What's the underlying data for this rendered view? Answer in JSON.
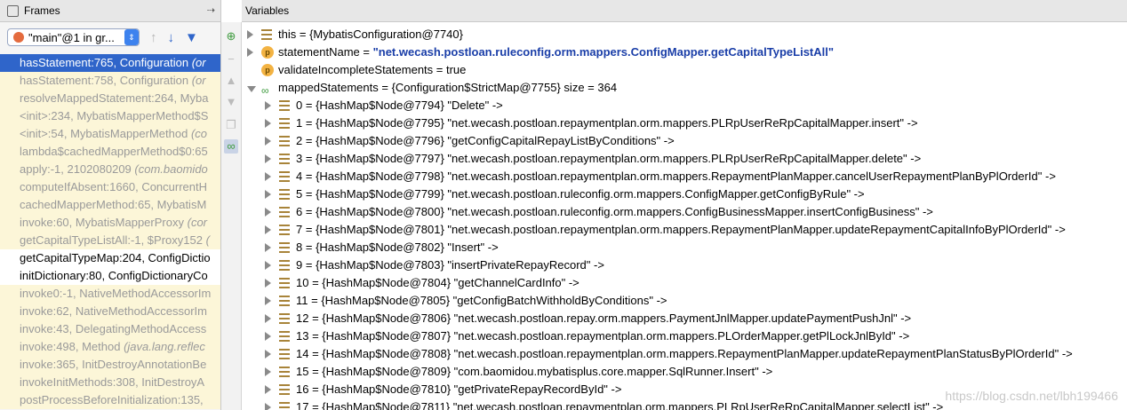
{
  "frames_panel": {
    "title": "Frames",
    "pin_glyph": "⇢",
    "thread_label": "\"main\"@1 in gr...",
    "frames": [
      {
        "method": "hasStatement:765, Configuration",
        "cls": "(or",
        "state": "selected"
      },
      {
        "method": "hasStatement:758, Configuration",
        "cls": "(or",
        "state": "lib"
      },
      {
        "method": "resolveMappedStatement:264, Myba",
        "cls": "",
        "state": "lib"
      },
      {
        "method": "<init>:234, MybatisMapperMethod$S",
        "cls": "",
        "state": "lib"
      },
      {
        "method": "<init>:54, MybatisMapperMethod",
        "cls": "(co",
        "state": "lib"
      },
      {
        "method": "lambda$cachedMapperMethod$0:65",
        "cls": "",
        "state": "lib"
      },
      {
        "method": "apply:-1, 2102080209",
        "cls": "(com.baomido",
        "state": "lib"
      },
      {
        "method": "computeIfAbsent:1660, ConcurrentH",
        "cls": "",
        "state": "lib"
      },
      {
        "method": "cachedMapperMethod:65, MybatisM",
        "cls": "",
        "state": "lib"
      },
      {
        "method": "invoke:60, MybatisMapperProxy",
        "cls": "(cor",
        "state": "lib"
      },
      {
        "method": "getCapitalTypeListAll:-1, $Proxy152",
        "cls": "(",
        "state": "lib"
      },
      {
        "method": "getCapitalTypeMap:204, ConfigDictio",
        "cls": "",
        "state": "own"
      },
      {
        "method": "initDictionary:80, ConfigDictionaryCo",
        "cls": "",
        "state": "own"
      },
      {
        "method": "invoke0:-1, NativeMethodAccessorIm",
        "cls": "",
        "state": "lib"
      },
      {
        "method": "invoke:62, NativeMethodAccessorIm",
        "cls": "",
        "state": "lib"
      },
      {
        "method": "invoke:43, DelegatingMethodAccess",
        "cls": "",
        "state": "lib"
      },
      {
        "method": "invoke:498, Method",
        "cls": "(java.lang.reflec",
        "state": "lib"
      },
      {
        "method": "invoke:365, InitDestroyAnnotationBe",
        "cls": "",
        "state": "lib"
      },
      {
        "method": "invokeInitMethods:308, InitDestroyA",
        "cls": "",
        "state": "lib"
      },
      {
        "method": "postProcessBeforeInitialization:135,",
        "cls": "",
        "state": "lib"
      }
    ]
  },
  "variables_panel": {
    "title": "Variables",
    "vars": [
      {
        "indent": 0,
        "expand": "right",
        "icon": "field",
        "name": "this",
        "value": "{MybatisConfiguration@7740}",
        "str": ""
      },
      {
        "indent": 0,
        "expand": "right",
        "icon": "param",
        "name": "statementName",
        "value": "",
        "str": "\"net.wecash.postloan.ruleconfig.orm.mappers.ConfigMapper.getCapitalTypeListAll\""
      },
      {
        "indent": 0,
        "expand": "none",
        "icon": "param",
        "name": "validateIncompleteStatements",
        "value": "true",
        "str": ""
      },
      {
        "indent": 0,
        "expand": "down",
        "icon": "watch",
        "name": "mappedStatements",
        "value": "{Configuration$StrictMap@7755}  size = 364",
        "str": ""
      },
      {
        "indent": 1,
        "expand": "right",
        "icon": "field",
        "name": "0",
        "value": "{HashMap$Node@7794} \"Delete\" ->",
        "str": ""
      },
      {
        "indent": 1,
        "expand": "right",
        "icon": "field",
        "name": "1",
        "value": "{HashMap$Node@7795} \"net.wecash.postloan.repaymentplan.orm.mappers.PLRpUserReRpCapitalMapper.insert\" ->",
        "str": ""
      },
      {
        "indent": 1,
        "expand": "right",
        "icon": "field",
        "name": "2",
        "value": "{HashMap$Node@7796} \"getConfigCapitalRepayListByConditions\" ->",
        "str": ""
      },
      {
        "indent": 1,
        "expand": "right",
        "icon": "field",
        "name": "3",
        "value": "{HashMap$Node@7797} \"net.wecash.postloan.repaymentplan.orm.mappers.PLRpUserReRpCapitalMapper.delete\" ->",
        "str": ""
      },
      {
        "indent": 1,
        "expand": "right",
        "icon": "field",
        "name": "4",
        "value": "{HashMap$Node@7798} \"net.wecash.postloan.repaymentplan.orm.mappers.RepaymentPlanMapper.cancelUserRepaymentPlanByPlOrderId\" ->",
        "str": ""
      },
      {
        "indent": 1,
        "expand": "right",
        "icon": "field",
        "name": "5",
        "value": "{HashMap$Node@7799} \"net.wecash.postloan.ruleconfig.orm.mappers.ConfigMapper.getConfigByRule\" ->",
        "str": ""
      },
      {
        "indent": 1,
        "expand": "right",
        "icon": "field",
        "name": "6",
        "value": "{HashMap$Node@7800} \"net.wecash.postloan.ruleconfig.orm.mappers.ConfigBusinessMapper.insertConfigBusiness\" ->",
        "str": ""
      },
      {
        "indent": 1,
        "expand": "right",
        "icon": "field",
        "name": "7",
        "value": "{HashMap$Node@7801} \"net.wecash.postloan.repaymentplan.orm.mappers.RepaymentPlanMapper.updateRepaymentCapitalInfoByPlOrderId\" ->",
        "str": ""
      },
      {
        "indent": 1,
        "expand": "right",
        "icon": "field",
        "name": "8",
        "value": "{HashMap$Node@7802} \"Insert\" ->",
        "str": ""
      },
      {
        "indent": 1,
        "expand": "right",
        "icon": "field",
        "name": "9",
        "value": "{HashMap$Node@7803} \"insertPrivateRepayRecord\" ->",
        "str": ""
      },
      {
        "indent": 1,
        "expand": "right",
        "icon": "field",
        "name": "10",
        "value": "{HashMap$Node@7804} \"getChannelCardInfo\" ->",
        "str": ""
      },
      {
        "indent": 1,
        "expand": "right",
        "icon": "field",
        "name": "11",
        "value": "{HashMap$Node@7805} \"getConfigBatchWithholdByConditions\" ->",
        "str": ""
      },
      {
        "indent": 1,
        "expand": "right",
        "icon": "field",
        "name": "12",
        "value": "{HashMap$Node@7806} \"net.wecash.postloan.repay.orm.mappers.PaymentJnlMapper.updatePaymentPushJnl\" ->",
        "str": ""
      },
      {
        "indent": 1,
        "expand": "right",
        "icon": "field",
        "name": "13",
        "value": "{HashMap$Node@7807} \"net.wecash.postloan.repaymentplan.orm.mappers.PLOrderMapper.getPlLockJnlById\" ->",
        "str": ""
      },
      {
        "indent": 1,
        "expand": "right",
        "icon": "field",
        "name": "14",
        "value": "{HashMap$Node@7808} \"net.wecash.postloan.repaymentplan.orm.mappers.RepaymentPlanMapper.updateRepaymentPlanStatusByPlOrderId\" ->",
        "str": ""
      },
      {
        "indent": 1,
        "expand": "right",
        "icon": "field",
        "name": "15",
        "value": "{HashMap$Node@7809} \"com.baomidou.mybatisplus.core.mapper.SqlRunner.Insert\" ->",
        "str": ""
      },
      {
        "indent": 1,
        "expand": "right",
        "icon": "field",
        "name": "16",
        "value": "{HashMap$Node@7810} \"getPrivateRepayRecordById\" ->",
        "str": ""
      },
      {
        "indent": 1,
        "expand": "right",
        "icon": "field",
        "name": "17",
        "value": "{HashMap$Node@7811} \"net.wecash.postloan.repaymentplan.orm.mappers.PLRpUserReRpCapitalMapper.selectList\" ->",
        "str": ""
      }
    ]
  },
  "watermark": "https://blog.csdn.net/lbh199466",
  "colors": {
    "selected_row": "#2f65ca",
    "library_row": "#fcf6d8",
    "string_value": "#1a3ea8"
  }
}
